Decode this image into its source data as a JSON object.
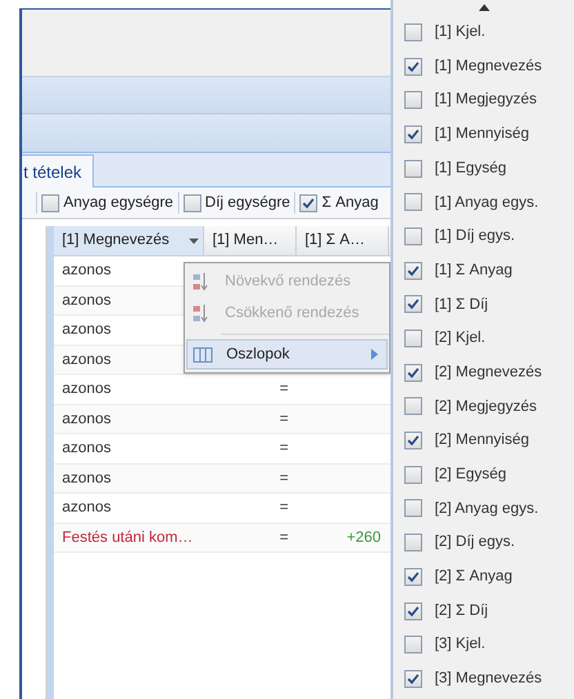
{
  "tabs": [
    {
      "label": "t tételek",
      "selected": true
    }
  ],
  "toolbar": [
    {
      "label": "Anyag egységre",
      "checked": false
    },
    {
      "label": "Díj egységre",
      "checked": false
    },
    {
      "label": "Σ Anyag",
      "checked": true
    }
  ],
  "grid": {
    "columns": [
      {
        "label": "[1] Megnevezés",
        "menu_open": true
      },
      {
        "label": "[1] Men…",
        "menu_open": false
      },
      {
        "label": "[1] Σ A…",
        "menu_open": false
      }
    ],
    "rows": [
      {
        "kind": "normal",
        "cells": [
          "azonos"
        ]
      },
      {
        "kind": "normal",
        "cells": [
          "azonos"
        ]
      },
      {
        "kind": "normal",
        "cells": [
          "azonos"
        ]
      },
      {
        "kind": "normal",
        "cells": [
          "azonos"
        ]
      },
      {
        "kind": "normal",
        "cells": [
          "azonos",
          "="
        ]
      },
      {
        "kind": "normal",
        "cells": [
          "azonos",
          "="
        ]
      },
      {
        "kind": "normal",
        "cells": [
          "azonos",
          "="
        ]
      },
      {
        "kind": "normal",
        "cells": [
          "azonos",
          "="
        ]
      },
      {
        "kind": "normal",
        "cells": [
          "azonos",
          "="
        ]
      },
      {
        "kind": "changed",
        "cells": [
          "Festés utáni kom…",
          "=",
          "+260"
        ]
      }
    ]
  },
  "column_menu": [
    {
      "kind": "sort-asc",
      "label": "Növekvő rendezés",
      "disabled": true,
      "selected": false
    },
    {
      "kind": "sort-desc",
      "label": "Csökkenő rendezés",
      "disabled": true,
      "selected": false
    },
    {
      "kind": "columns",
      "label": "Oszlopok",
      "disabled": false,
      "selected": true
    }
  ],
  "column_picker": [
    {
      "label": "[1] Kjel.",
      "checked": false
    },
    {
      "label": "[1] Megnevezés",
      "checked": true
    },
    {
      "label": "[1] Megjegyzés",
      "checked": false
    },
    {
      "label": "[1] Mennyiség",
      "checked": true
    },
    {
      "label": "[1] Egység",
      "checked": false
    },
    {
      "label": "[1] Anyag egys.",
      "checked": false
    },
    {
      "label": "[1] Díj egys.",
      "checked": false
    },
    {
      "label": "[1] Σ Anyag",
      "checked": true
    },
    {
      "label": "[1] Σ Díj",
      "checked": true
    },
    {
      "label": "[2] Kjel.",
      "checked": false
    },
    {
      "label": "[2] Megnevezés",
      "checked": true
    },
    {
      "label": "[2] Megjegyzés",
      "checked": false
    },
    {
      "label": "[2] Mennyiség",
      "checked": true
    },
    {
      "label": "[2] Egység",
      "checked": false
    },
    {
      "label": "[2] Anyag egys.",
      "checked": false
    },
    {
      "label": "[2] Díj egys.",
      "checked": false
    },
    {
      "label": "[2] Σ Anyag",
      "checked": true
    },
    {
      "label": "[2] Σ Díj",
      "checked": true
    },
    {
      "label": "[3] Kjel.",
      "checked": false
    },
    {
      "label": "[3] Megnevezés",
      "checked": true
    }
  ]
}
